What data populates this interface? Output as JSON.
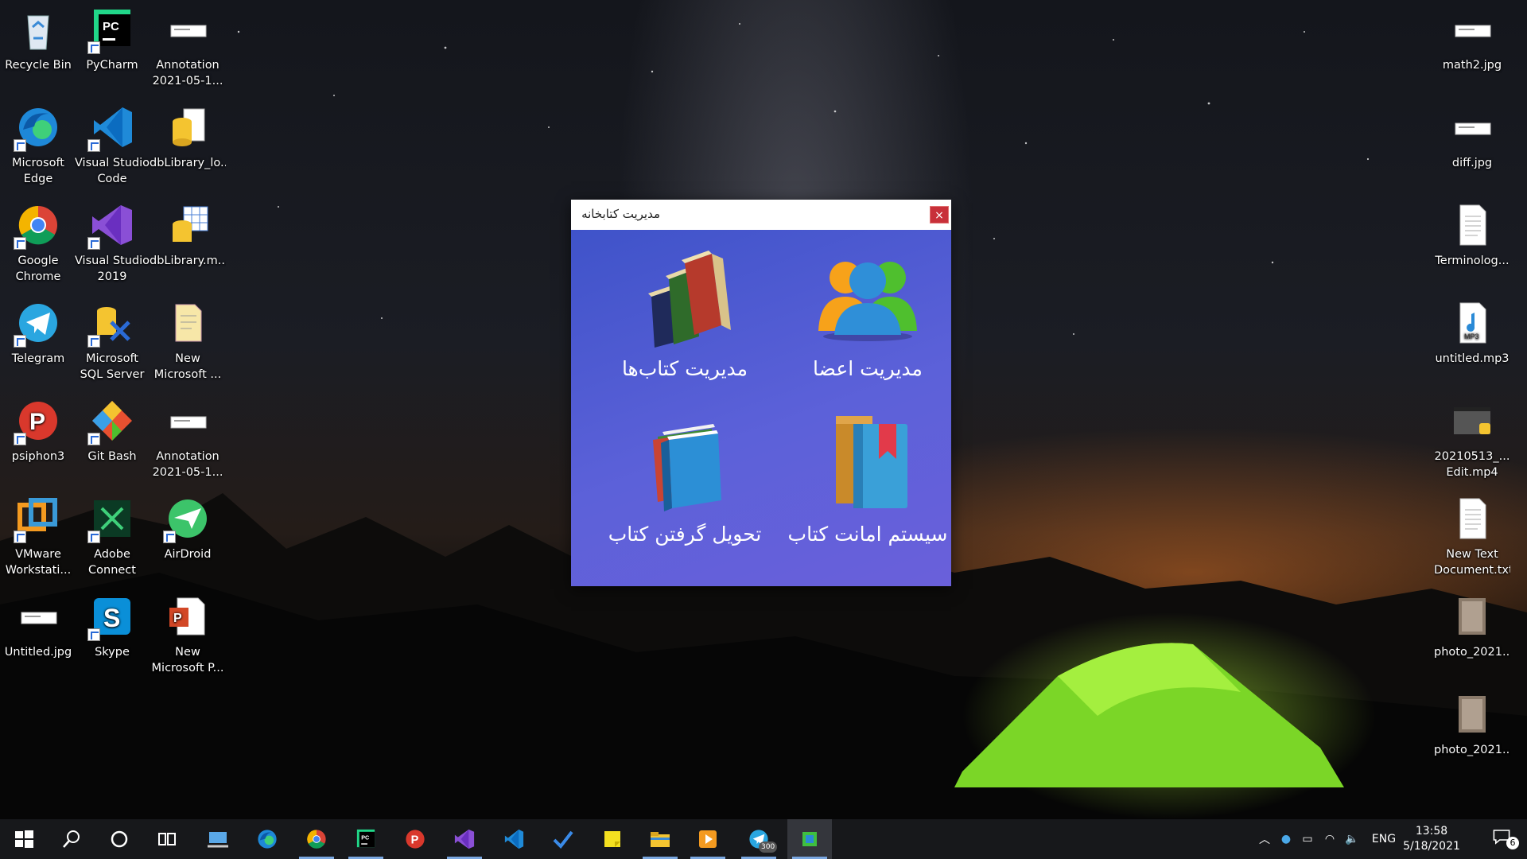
{
  "desktop": {
    "icons_left": [
      {
        "label": "Recycle Bin",
        "icon": "recycle-bin-icon",
        "shortcut": false
      },
      {
        "label": "PyCharm",
        "icon": "pycharm-icon",
        "shortcut": true
      },
      {
        "label": "Annotation\n2021-05-1...",
        "icon": "image-file-icon",
        "shortcut": false
      },
      {
        "label": "Microsoft\nEdge",
        "icon": "edge-icon",
        "shortcut": true
      },
      {
        "label": "Visual Studio\nCode",
        "icon": "vscode-icon",
        "shortcut": true
      },
      {
        "label": "dbLibrary_lo...",
        "icon": "database-file-icon",
        "shortcut": false
      },
      {
        "label": "Google\nChrome",
        "icon": "chrome-icon",
        "shortcut": true
      },
      {
        "label": "Visual Studio\n2019",
        "icon": "visual-studio-icon",
        "shortcut": true
      },
      {
        "label": "dbLibrary.m...",
        "icon": "database-table-icon",
        "shortcut": false
      },
      {
        "label": "Telegram",
        "icon": "telegram-icon",
        "shortcut": true
      },
      {
        "label": "Microsoft\nSQL Server ...",
        "icon": "sql-server-icon",
        "shortcut": true
      },
      {
        "label": "New\nMicrosoft ...",
        "icon": "document-file-icon",
        "shortcut": false
      },
      {
        "label": "psiphon3",
        "icon": "psiphon-icon",
        "shortcut": true
      },
      {
        "label": "Git Bash",
        "icon": "git-bash-icon",
        "shortcut": true
      },
      {
        "label": "Annotation\n2021-05-1...",
        "icon": "image-file-icon",
        "shortcut": false
      },
      {
        "label": "VMware\nWorkstati...",
        "icon": "vmware-icon",
        "shortcut": true
      },
      {
        "label": "Adobe\nConnect",
        "icon": "adobe-connect-icon",
        "shortcut": true
      },
      {
        "label": "AirDroid",
        "icon": "airdroid-icon",
        "shortcut": true
      },
      {
        "label": "Untitled.jpg",
        "icon": "image-file-icon",
        "shortcut": false
      },
      {
        "label": "Skype",
        "icon": "skype-icon",
        "shortcut": true
      },
      {
        "label": "New\nMicrosoft P...",
        "icon": "powerpoint-file-icon",
        "shortcut": false
      }
    ],
    "icons_right": [
      {
        "label": "math2.jpg",
        "icon": "image-file-icon"
      },
      {
        "label": "diff.jpg",
        "icon": "image-file-icon"
      },
      {
        "label": "Terminolog...",
        "icon": "text-file-icon"
      },
      {
        "label": "untitled.mp3",
        "icon": "mp3-file-icon"
      },
      {
        "label": "20210513_...\nEdit.mp4",
        "icon": "video-file-icon"
      },
      {
        "label": "New Text\nDocument.txt",
        "icon": "text-file-icon"
      },
      {
        "label": "photo_2021...",
        "icon": "photo-file-icon"
      },
      {
        "label": "photo_2021...",
        "icon": "photo-file-icon"
      }
    ]
  },
  "window": {
    "title": "مدیریت کتابخانه",
    "close_label": "×",
    "tiles": {
      "members": "مدیریت اعضا",
      "books": "مدیریت کتاب‌ها",
      "lending": "سیستم امانت کتاب",
      "return": "تحویل گرفتن کتاب"
    }
  },
  "taskbar": {
    "apps": [
      "start-icon",
      "search-icon",
      "cortana-icon",
      "task-view-icon",
      "computer-icon",
      "edge-icon",
      "chrome-icon",
      "pycharm-icon",
      "psiphon-icon",
      "visual-studio-icon",
      "vscode-icon",
      "todo-icon",
      "sticky-notes-icon",
      "file-explorer-icon",
      "media-player-icon",
      "telegram-icon",
      "library-app-icon"
    ],
    "telegram_badge": "300",
    "language": "ENG",
    "time": "13:58",
    "date": "5/18/2021",
    "notifications_count": "6"
  },
  "colors": {
    "window_bg_start": "#3f53c9",
    "window_bg_end": "#6a60da",
    "close_button": "#c8303a",
    "taskbar": "#17181b"
  }
}
